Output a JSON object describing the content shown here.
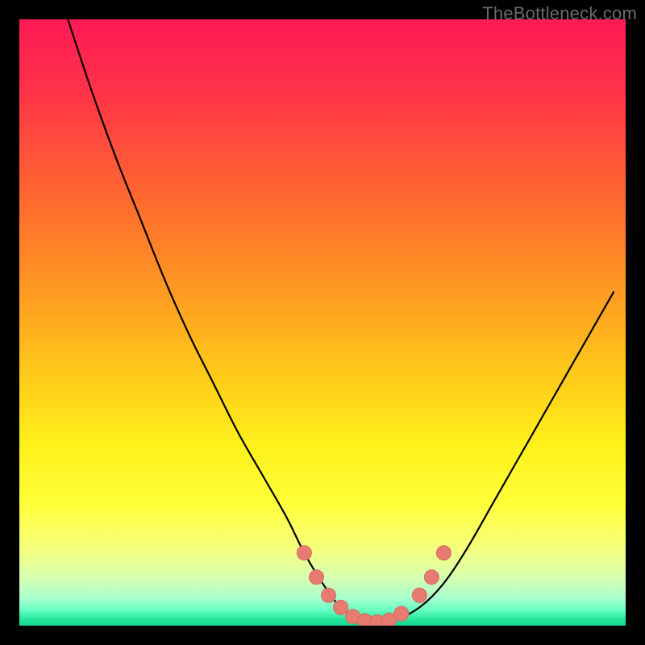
{
  "watermark": "TheBottleneck.com",
  "colors": {
    "black": "#000000",
    "curve": "#000000",
    "marker_fill": "#e77b72",
    "marker_stroke": "#d86a60",
    "gradient_stops": [
      {
        "offset": "0%",
        "color": "#ff1a55"
      },
      {
        "offset": "12%",
        "color": "#ff3348"
      },
      {
        "offset": "30%",
        "color": "#ff6a2f"
      },
      {
        "offset": "45%",
        "color": "#ff9a22"
      },
      {
        "offset": "58%",
        "color": "#ffc81a"
      },
      {
        "offset": "70%",
        "color": "#fff01a"
      },
      {
        "offset": "80%",
        "color": "#ffff3a"
      },
      {
        "offset": "87%",
        "color": "#f7ff7a"
      },
      {
        "offset": "92%",
        "color": "#d8ffb0"
      },
      {
        "offset": "95.5%",
        "color": "#a8ffd0"
      },
      {
        "offset": "97.5%",
        "color": "#66ffc0"
      },
      {
        "offset": "99%",
        "color": "#22e59a"
      },
      {
        "offset": "100%",
        "color": "#12d98f"
      }
    ]
  },
  "chart_data": {
    "type": "line",
    "title": "",
    "subtitle": "",
    "xlabel": "",
    "ylabel": "",
    "xlim": [
      0,
      100
    ],
    "ylim": [
      0,
      100
    ],
    "grid": false,
    "legend": false,
    "annotations": [
      "TheBottleneck.com"
    ],
    "series": [
      {
        "name": "bottleneck-curve",
        "x": [
          8,
          12,
          16,
          20,
          24,
          28,
          32,
          36,
          40,
          44,
          47,
          50,
          53,
          56,
          59,
          62,
          66,
          70,
          74,
          78,
          82,
          86,
          90,
          94,
          98
        ],
        "y": [
          100,
          88,
          77,
          67,
          57,
          48,
          40,
          32,
          25,
          18,
          12,
          7,
          3,
          1,
          0.5,
          1,
          3,
          7,
          13,
          20,
          27,
          34,
          41,
          48,
          55
        ]
      }
    ],
    "markers": [
      {
        "x": 47,
        "y": 12
      },
      {
        "x": 49,
        "y": 8
      },
      {
        "x": 51,
        "y": 5
      },
      {
        "x": 53,
        "y": 3
      },
      {
        "x": 55,
        "y": 1.5
      },
      {
        "x": 57,
        "y": 0.8
      },
      {
        "x": 59,
        "y": 0.6
      },
      {
        "x": 61,
        "y": 0.9
      },
      {
        "x": 63,
        "y": 2
      },
      {
        "x": 66,
        "y": 5
      },
      {
        "x": 68,
        "y": 8
      },
      {
        "x": 70,
        "y": 12
      }
    ]
  }
}
